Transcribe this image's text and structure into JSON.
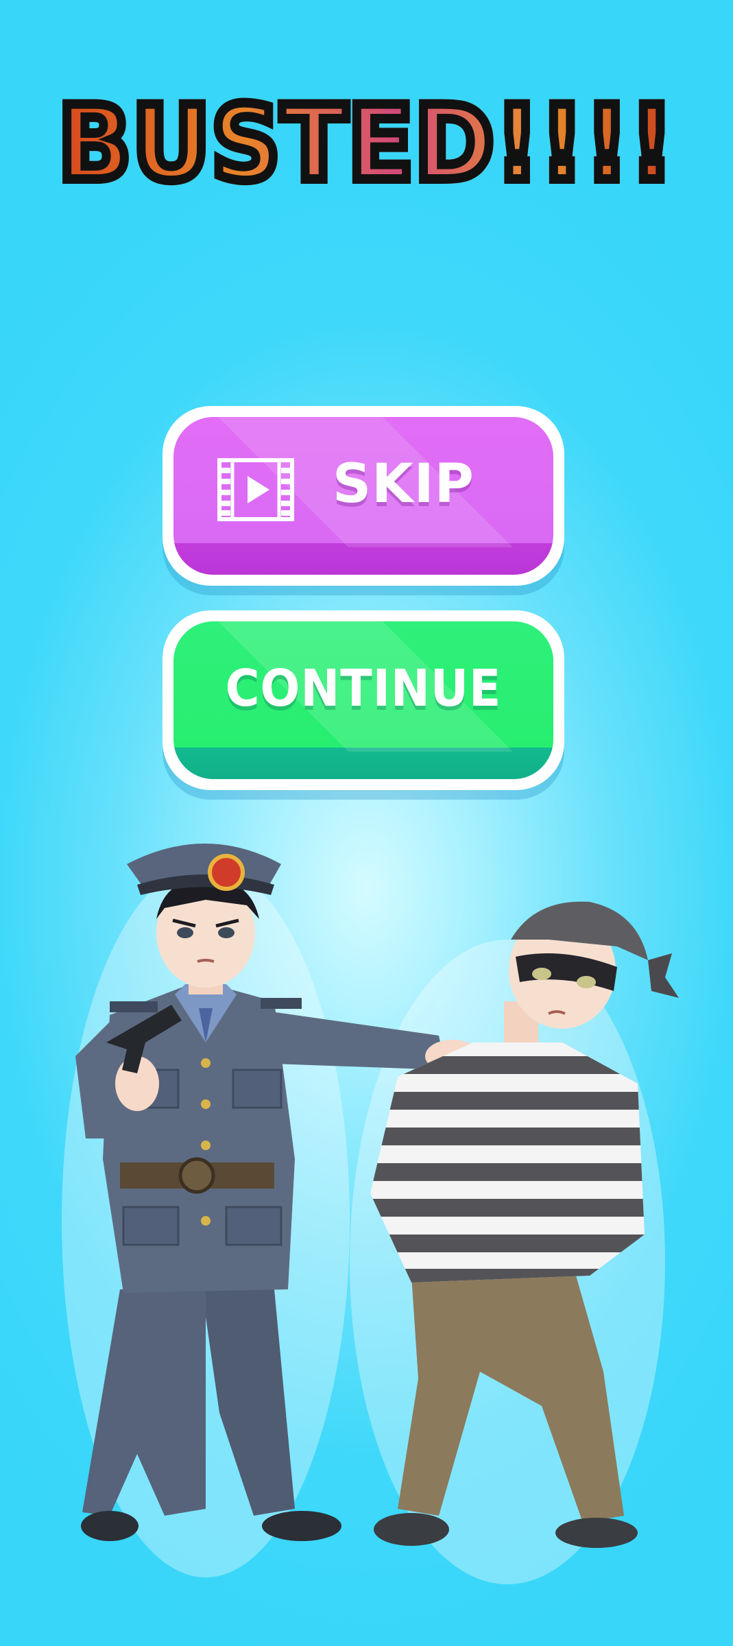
{
  "title": "BUSTED!!!!",
  "buttons": {
    "skip_label": "SKIP",
    "continue_label": "CONTINUE"
  },
  "icons": {
    "skip_icon": "video-play-icon"
  },
  "colors": {
    "background": "#38d6f9",
    "skip_button": "#d96af4",
    "continue_button": "#27ee70",
    "title_stroke": "#111111"
  }
}
